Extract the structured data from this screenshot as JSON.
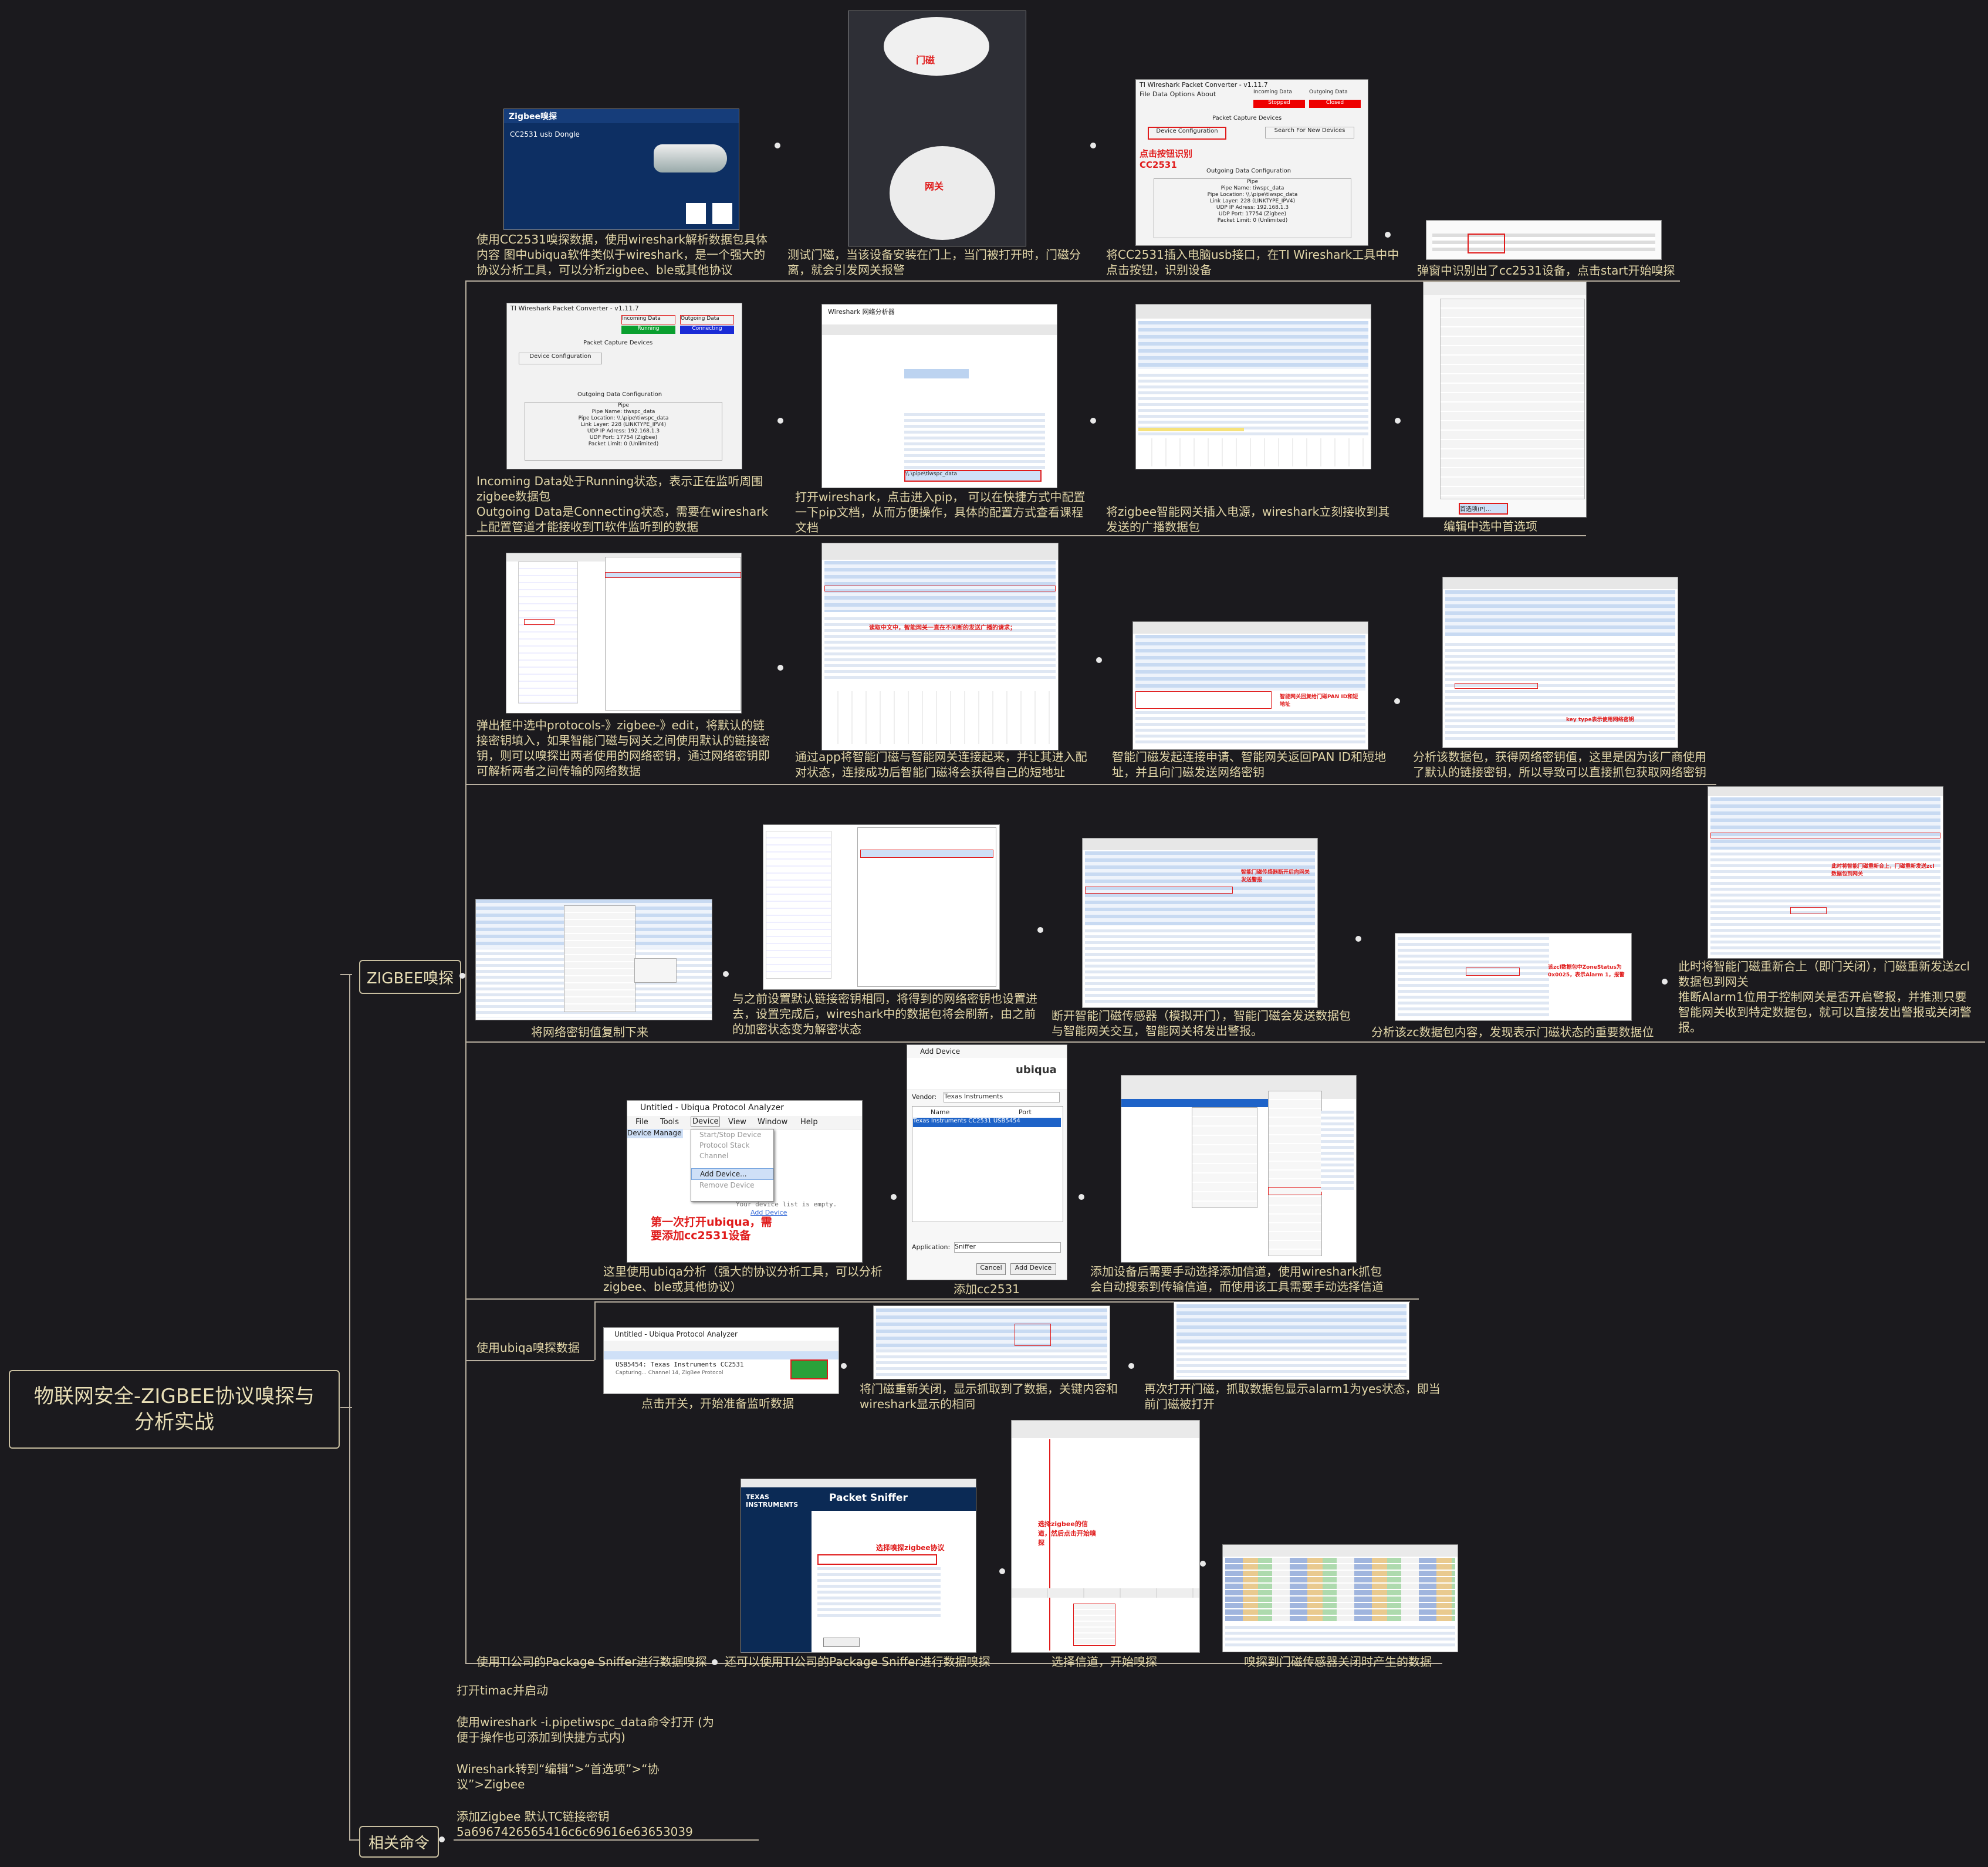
{
  "root": {
    "title": "物联网安全-ZIGBEE协议嗅探与分析实战"
  },
  "branches": {
    "sniff": "ZIGBEE嗅探",
    "commands": "相关命令"
  },
  "row1": {
    "c1": "使用CC2531嗅探数据，使用wireshark解析数据包具体内容  图中ubiqua软件类似于wireshark，是一个强大的协议分析工具，可以分析zigbee、ble或其他协议",
    "c2": "测试门磁，当该设备安装在门上，当门被打开时，门磁分离，就会引发网关报警",
    "c3": "将CC2531插入电脑usb接口，在TI Wireshark工具中中点击按钮，识别设备",
    "c4": "弹窗中识别出了cc2531设备，点击start开始嗅探"
  },
  "row2": {
    "c1": "Incoming Data处于Running状态，表示正在监听周围zigbee数据包\nOutgoing Data是Connecting状态，需要在wireshark上配置管道才能接收到TI软件监听到的数据",
    "c2": "打开wireshark，点击进入pip，\n可以在快捷方式中配置一下pip文档，从而方便操作，具体的配置方式查看课程文档",
    "c3": "将zigbee智能网关插入电源，wireshark立刻接收到其发送的广播数据包",
    "c4": "编辑中选中首选项"
  },
  "row3": {
    "c1": "弹出框中选中protocols-》zigbee-》edit，将默认的链接密钥填入，如果智能门磁与网关之间使用默认的链接密钥，则可以嗅探出两者使用的网络密钥，通过网络密钥即可解析两者之间传输的网络数据",
    "c2": "通过app将智能门磁与智能网关连接起来，并让其进入配对状态，连接成功后智能门磁将会获得自己的短地址",
    "c3": "智能门磁发起连接申请、智能网关返回PAN ID和短地址，并且向门磁发送网络密钥",
    "c4": "分析该数据包，获得网络密钥值，这里是因为该厂商使用了默认的链接密钥，所以导致可以直接抓包获取网络密钥"
  },
  "row4": {
    "c1": "将网络密钥值复制下来",
    "c2": "与之前设置默认链接密钥相同，将得到的网络密钥也设置进去，设置完成后，wireshark中的数据包将会刷新，由之前的加密状态变为解密状态",
    "c3": "断开智能门磁传感器（模拟开门），智能门磁会发送数据包与智能网关交互，智能网关将发出警报。",
    "c4": "分析该zc数据包内容，发现表示门磁状态的重要数据位",
    "c5": "此时将智能门磁重新合上（即门关闭），门磁重新发送zcl数据包到网关\n推断Alarm1位用于控制网关是否开启警报，并推测只要智能网关收到特定数据包，就可以直接发出警报或关闭警报。"
  },
  "row5": {
    "c1": "这里使用ubiqa分析（强大的协议分析工具，可以分析zigbee、ble或其他协议）",
    "c2": "添加cc2531",
    "c3": "添加设备后需要手动选择添加信道，使用wireshark抓包会自动搜索到传输信道，而使用该工具需要手动选择信道"
  },
  "row6": {
    "label": "使用ubiqa嗅探数据",
    "c1": "点击开关，开始准备监听数据",
    "c2": "将门磁重新关闭，显示抓取到了数据，关键内容和wireshark显示的相同",
    "c3": "再次打开门磁，抓取数据包显示alarm1为yes状态，即当前门磁被打开"
  },
  "row7": {
    "label": "使用TI公司的Package Sniffer进行数据嗅探",
    "c1": "还可以使用TI公司的Package Sniffer进行数据嗅探",
    "c2": "选择信道，开始嗅探",
    "c3": "嗅探到门磁传感器关闭时产生的数据"
  },
  "commands": {
    "l1": "打开timac并启动",
    "l2": "使用wireshark -i.pipetiwspc_data命令打开   (为便于操作也可添加到快捷方式内)",
    "l3": "Wireshark转到“编辑”>“首选项”>“协议”>Zigbee",
    "l4": "添加Zigbee 默认TC链接密钥",
    "l5": "5a6967426565416c6c69616e63653039"
  },
  "shots": {
    "dongle_title": "Zigbee嗅探",
    "dongle_sub": "CC2531 usb Dongle",
    "door_label": "门磁",
    "gw_label": "网关",
    "ti_title": "TI Wireshark Packet Converter - v1.11.7",
    "ti_menu": "File   Data   Options   About",
    "ti_incoming": "Incoming Data",
    "ti_outgoing": "Outgoing Data",
    "ti_stopped": "Stopped",
    "ti_closed": "Closed",
    "ti_running": "Running",
    "ti_connecting": "Connecting",
    "ti_devices": "Packet Capture Devices",
    "ti_devconf": "Device Configuration",
    "ti_search": "Search For New Devices",
    "ti_click_note": "点击按钮识别CC2531",
    "ti_outconf": "Outgoing Data Configuration",
    "ti_pipe": "Pipe\nPipe Name: tiwspc_data\nPipe Location: \\\\.\\pipe\\tiwspc_data\nLink Layer: 228 (LINKTYPE_IPV4)\nUDP IP Adress: 192.168.1.3\nUDP Port: 17754 (Zigbee)\nPacket Limit: 0 (Unlimited)",
    "ubq_title": "Untitled - Ubiqua Protocol Analyzer",
    "ubq_menu": [
      "File",
      "Tools",
      "Device",
      "View",
      "Window",
      "Help"
    ],
    "ubq_dd": [
      "Start/Stop Device",
      "Protocol Stack",
      "Channel",
      "Add Device...",
      "Remove Device"
    ],
    "ubq_devmgr": "Device Manage",
    "ubq_note": "第一次打开ubiqua，需要添加cc2531设备",
    "ubq_empty": "Your device list is empty.",
    "ubq_addlink": "Add Device",
    "add_title": "Add Device",
    "add_brand": "ubiqua",
    "add_vendor_label": "Vendor:",
    "add_vendor": "Texas Instruments",
    "add_col_name": "Name",
    "add_col_port": "Port",
    "add_row": "Texas Instruments CC2531   USB5454",
    "add_app_label": "Application:",
    "add_app": "Sniffer",
    "add_cancel": "Cancel",
    "add_add": "Add Device",
    "dm_title": "Untitled - Ubiqua Protocol Analyzer",
    "dm_row": "USB5454: Texas Instruments CC2531",
    "dm_sub": "Capturing... Channel 14, ZigBee Protocol",
    "ps_title": "Packet Sniffer",
    "ps_brand": "TEXAS INSTRUMENTS",
    "ps_note": "选择嗅探zigbee协议",
    "ps_sel": "选择zigbee的信道，然后点击开始嗅探",
    "ws_title": "Wireshark 网络分析器",
    "ws_pipe": "\\\\.\\pipe\\tiwspc_data",
    "edit_menu_last": "首选项(P)..."
  },
  "colors": {
    "bg": "#1b1a1e",
    "text": "#e2d6a8",
    "line": "#b9b0a0",
    "accent_red": "#e01b1b"
  }
}
